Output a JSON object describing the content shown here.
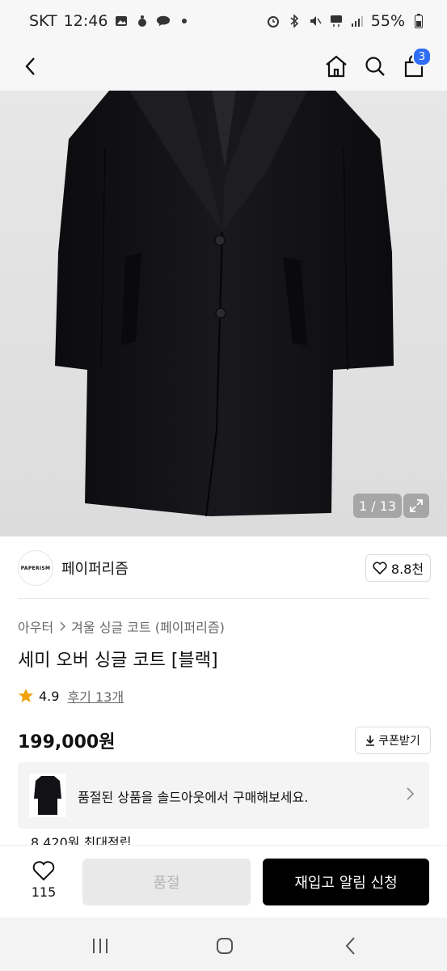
{
  "status_bar": {
    "carrier": "SKT",
    "time": "12:46",
    "battery": "55%"
  },
  "nav": {
    "cart_count": "3"
  },
  "gallery": {
    "counter": "1 / 13"
  },
  "brand": {
    "logo_text": "PAPERISM",
    "name": "페이퍼리즘",
    "likes": "8.8천"
  },
  "product": {
    "breadcrumb": [
      "아우터",
      "겨울 싱글 코트 (페이퍼리즘)"
    ],
    "title": "세미 오버 싱글 코트 [블랙]",
    "rating": "4.9",
    "reviews": "후기 13개",
    "price": "199,000원",
    "coupon_label": "쿠폰받기"
  },
  "soldout_banner": {
    "text": "품절된 상품을 솔드아웃에서 구매해보세요."
  },
  "points": {
    "text": "8,420원 최대적립"
  },
  "bottom_bar": {
    "like_count": "115",
    "soldout_label": "품절",
    "notify_label": "재입고 알림 신청"
  },
  "colors": {
    "accent_badge": "#2f6df5",
    "star": "#f2a20c",
    "primary_button": "#000000"
  }
}
